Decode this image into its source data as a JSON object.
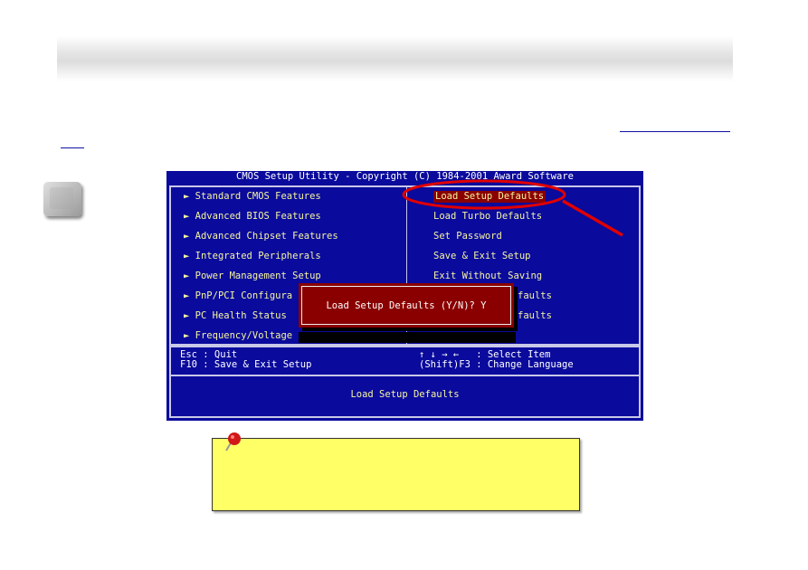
{
  "bios": {
    "title": "CMOS Setup Utility - Copyright (C) 1984-2001 Award Software",
    "left_items": [
      "Standard CMOS Features",
      "Advanced BIOS Features",
      "Advanced Chipset Features",
      "Integrated Peripherals",
      "Power Management Setup",
      "PnP/PCI Configura",
      "PC Health Status",
      "Frequency/Voltage"
    ],
    "right_items": [
      "Load Setup Defaults",
      "Load Turbo Defaults",
      "Set Password",
      "Save & Exit Setup",
      "Exit Without Saving",
      "faults",
      "faults"
    ],
    "selected": "Load Setup Defaults",
    "footer": {
      "esc": "Esc : Quit",
      "f10": "F10 : Save & Exit Setup",
      "arrows": "↑ ↓ → ←   : Select Item",
      "shift": "(Shift)F3 : Change Language"
    },
    "help": "Load Setup Defaults",
    "dialog": "Load Setup Defaults (Y/N)? Y"
  },
  "colors": {
    "bios_bg": "#0a0a9c",
    "bios_text": "#f5f5a0",
    "highlight": "#8a0000",
    "annotation": "#e00000",
    "note": "#ffff66"
  }
}
